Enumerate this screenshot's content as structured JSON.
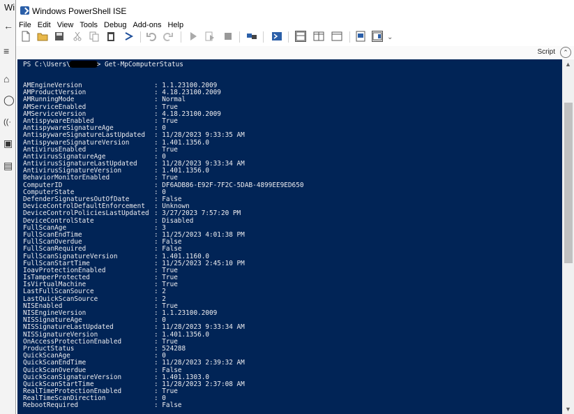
{
  "background": {
    "fragment_text": "Wi",
    "icons": [
      "back-arrow-icon",
      "hamburger-menu-icon",
      "home-icon",
      "shield-icon",
      "wifi-icon",
      "window-icon",
      "laptop-icon"
    ]
  },
  "window": {
    "title": "Windows PowerShell ISE"
  },
  "menu": [
    "File",
    "Edit",
    "View",
    "Tools",
    "Debug",
    "Add-ons",
    "Help"
  ],
  "toolbar": {
    "icons": [
      "new-file-icon",
      "open-folder-icon",
      "save-icon",
      "cut-icon",
      "copy-icon",
      "paste-icon",
      "clear-console-icon",
      "undo-icon",
      "redo-icon",
      "run-icon",
      "run-selection-icon",
      "stop-icon",
      "remote-tab-icon",
      "start-powershell-icon",
      "show-script-pane-top-icon",
      "show-script-pane-right-icon",
      "show-script-pane-max-icon",
      "show-command-window-icon",
      "show-command-addon-icon"
    ],
    "overflow": "⌄"
  },
  "script_pane": {
    "label": "Script",
    "toggle_glyph": "⌃"
  },
  "console": {
    "prompt_prefix": "PS C:\\Users\\",
    "prompt_suffix": "> Get-MpComputerStatus",
    "rows": [
      {
        "key": "AMEngineVersion",
        "value": ": 1.1.23100.2009"
      },
      {
        "key": "AMProductVersion",
        "value": ": 4.18.23100.2009"
      },
      {
        "key": "AMRunningMode",
        "value": ": Normal"
      },
      {
        "key": "AMServiceEnabled",
        "value": ": True"
      },
      {
        "key": "AMServiceVersion",
        "value": ": 4.18.23100.2009"
      },
      {
        "key": "AntispywareEnabled",
        "value": ": True"
      },
      {
        "key": "AntispywareSignatureAge",
        "value": ": 0"
      },
      {
        "key": "AntispywareSignatureLastUpdated",
        "value": ": 11/28/2023 9:33:35 AM"
      },
      {
        "key": "AntispywareSignatureVersion",
        "value": ": 1.401.1356.0"
      },
      {
        "key": "AntivirusEnabled",
        "value": ": True"
      },
      {
        "key": "AntivirusSignatureAge",
        "value": ": 0"
      },
      {
        "key": "AntivirusSignatureLastUpdated",
        "value": ": 11/28/2023 9:33:34 AM"
      },
      {
        "key": "AntivirusSignatureVersion",
        "value": ": 1.401.1356.0"
      },
      {
        "key": "BehaviorMonitorEnabled",
        "value": ": True"
      },
      {
        "key": "ComputerID",
        "value": ": DF6ADB86-E92F-7F2C-5DAB-4899EE9ED650"
      },
      {
        "key": "ComputerState",
        "value": ": 0"
      },
      {
        "key": "DefenderSignaturesOutOfDate",
        "value": ": False"
      },
      {
        "key": "DeviceControlDefaultEnforcement",
        "value": ": Unknown"
      },
      {
        "key": "DeviceControlPoliciesLastUpdated",
        "value": ": 3/27/2023 7:57:20 PM"
      },
      {
        "key": "DeviceControlState",
        "value": ": Disabled"
      },
      {
        "key": "FullScanAge",
        "value": ": 3"
      },
      {
        "key": "FullScanEndTime",
        "value": ": 11/25/2023 4:01:38 PM"
      },
      {
        "key": "FullScanOverdue",
        "value": ": False"
      },
      {
        "key": "FullScanRequired",
        "value": ": False"
      },
      {
        "key": "FullScanSignatureVersion",
        "value": ": 1.401.1160.0"
      },
      {
        "key": "FullScanStartTime",
        "value": ": 11/25/2023 2:45:10 PM"
      },
      {
        "key": "IoavProtectionEnabled",
        "value": ": True"
      },
      {
        "key": "IsTamperProtected",
        "value": ": True"
      },
      {
        "key": "IsVirtualMachine",
        "value": ": True"
      },
      {
        "key": "LastFullScanSource",
        "value": ": 2"
      },
      {
        "key": "LastQuickScanSource",
        "value": ": 2"
      },
      {
        "key": "NISEnabled",
        "value": ": True"
      },
      {
        "key": "NISEngineVersion",
        "value": ": 1.1.23100.2009"
      },
      {
        "key": "NISSignatureAge",
        "value": ": 0"
      },
      {
        "key": "NISSignatureLastUpdated",
        "value": ": 11/28/2023 9:33:34 AM"
      },
      {
        "key": "NISSignatureVersion",
        "value": ": 1.401.1356.0"
      },
      {
        "key": "OnAccessProtectionEnabled",
        "value": ": True"
      },
      {
        "key": "ProductStatus",
        "value": ": 524288"
      },
      {
        "key": "QuickScanAge",
        "value": ": 0"
      },
      {
        "key": "QuickScanEndTime",
        "value": ": 11/28/2023 2:39:32 AM"
      },
      {
        "key": "QuickScanOverdue",
        "value": ": False"
      },
      {
        "key": "QuickScanSignatureVersion",
        "value": ": 1.401.1303.0"
      },
      {
        "key": "QuickScanStartTime",
        "value": ": 11/28/2023 2:37:08 AM"
      },
      {
        "key": "RealTimeProtectionEnabled",
        "value": ": True"
      },
      {
        "key": "RealTimeScanDirection",
        "value": ": 0"
      },
      {
        "key": "RebootRequired",
        "value": ": False"
      }
    ]
  },
  "colors": {
    "console_bg": "#012456",
    "console_fg": "#eeedf0",
    "accent": "#2b5fa8"
  }
}
